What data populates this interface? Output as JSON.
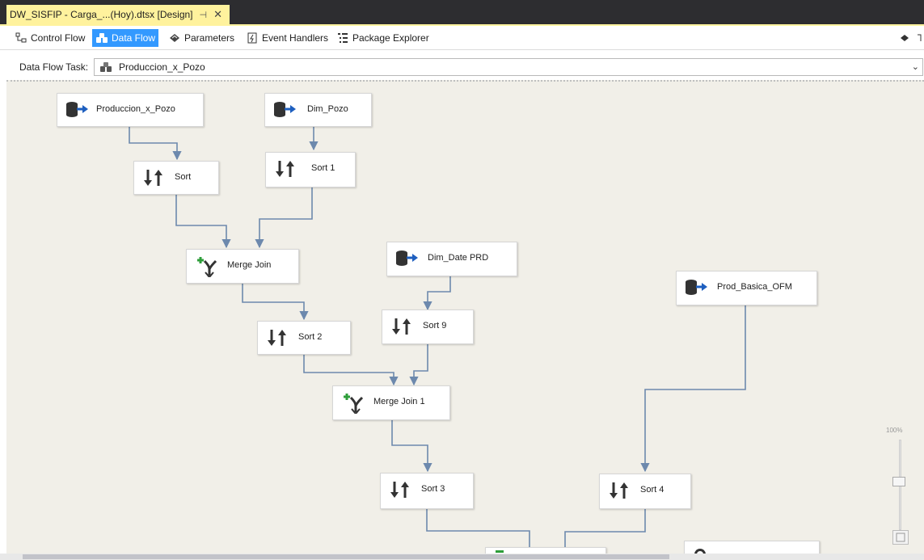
{
  "document_tab": {
    "title": "DW_SISFIP - Carga_...(Hoy).dtsx [Design]",
    "pin": "⊣",
    "close": "✕"
  },
  "designer_tabs": [
    {
      "label": "Control Flow",
      "icon": "control-flow-icon",
      "active": false
    },
    {
      "label": "Data Flow",
      "icon": "data-flow-icon",
      "active": true
    },
    {
      "label": "Parameters",
      "icon": "parameters-icon",
      "active": false
    },
    {
      "label": "Event Handlers",
      "icon": "event-handlers-icon",
      "active": false
    },
    {
      "label": "Package Explorer",
      "icon": "package-explorer-icon",
      "active": false
    }
  ],
  "task": {
    "label": "Data Flow Task:",
    "selected": "Produccion_x_Pozo",
    "chevron": "⌄"
  },
  "nodes": {
    "produccion_x_pozo": {
      "label": "Produccion_x_Pozo",
      "kind": "source"
    },
    "dim_pozo": {
      "label": "Dim_Pozo",
      "kind": "source"
    },
    "sort": {
      "label": "Sort",
      "kind": "sort"
    },
    "sort_1": {
      "label": "Sort 1",
      "kind": "sort"
    },
    "merge_join": {
      "label": "Merge Join",
      "kind": "merge"
    },
    "dim_date_prd": {
      "label": "Dim_Date PRD",
      "kind": "source"
    },
    "prod_basica_ofm": {
      "label": "Prod_Basica_OFM",
      "kind": "source"
    },
    "sort_2": {
      "label": "Sort 2",
      "kind": "sort"
    },
    "sort_9": {
      "label": "Sort 9",
      "kind": "sort"
    },
    "merge_join_1": {
      "label": "Merge Join 1",
      "kind": "merge"
    },
    "sort_3": {
      "label": "Sort 3",
      "kind": "sort"
    },
    "sort_4": {
      "label": "Sort 4",
      "kind": "sort"
    }
  },
  "zoom": {
    "level": "100%"
  },
  "colors": {
    "tab_highlight": "#fff29d",
    "active_tab": "#3399ff",
    "canvas": "#f1efe8",
    "wire": "#6d89ad",
    "source_arrow": "#1e5fbf",
    "merge_plus": "#2e9e3a"
  }
}
